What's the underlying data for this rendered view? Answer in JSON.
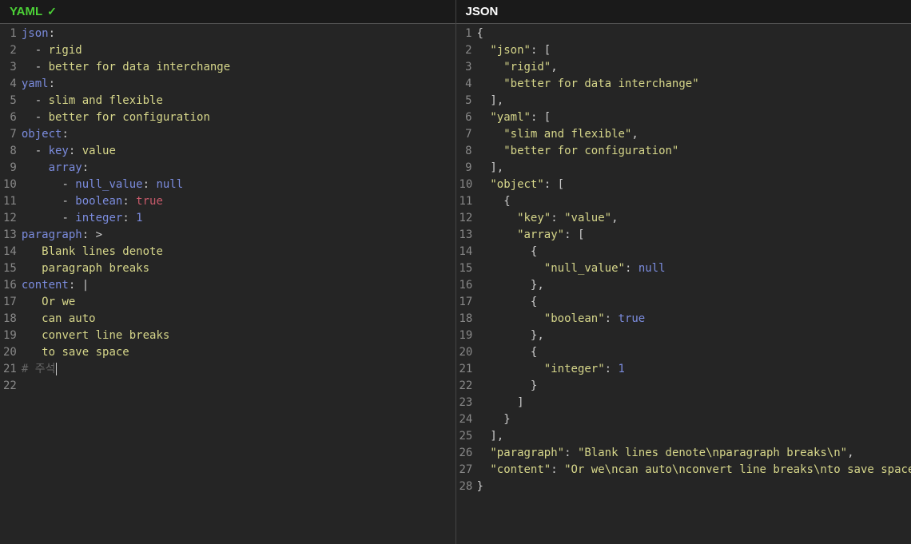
{
  "headers": {
    "yaml": "YAML",
    "check": "✓",
    "json": "JSON"
  },
  "yaml_lines": [
    {
      "n": 1,
      "tokens": [
        [
          "k",
          "json"
        ],
        [
          "p",
          ":"
        ]
      ]
    },
    {
      "n": 2,
      "tokens": [
        [
          "p",
          "  "
        ],
        [
          "d",
          "- "
        ],
        [
          "s",
          "rigid"
        ]
      ]
    },
    {
      "n": 3,
      "tokens": [
        [
          "p",
          "  "
        ],
        [
          "d",
          "- "
        ],
        [
          "s",
          "better for data interchange"
        ]
      ]
    },
    {
      "n": 4,
      "tokens": [
        [
          "k",
          "yaml"
        ],
        [
          "p",
          ":"
        ]
      ]
    },
    {
      "n": 5,
      "tokens": [
        [
          "p",
          "  "
        ],
        [
          "d",
          "- "
        ],
        [
          "s",
          "slim and flexible"
        ]
      ]
    },
    {
      "n": 6,
      "tokens": [
        [
          "p",
          "  "
        ],
        [
          "d",
          "- "
        ],
        [
          "s",
          "better for configuration"
        ]
      ]
    },
    {
      "n": 7,
      "tokens": [
        [
          "k",
          "object"
        ],
        [
          "p",
          ":"
        ]
      ]
    },
    {
      "n": 8,
      "tokens": [
        [
          "p",
          "  "
        ],
        [
          "d",
          "- "
        ],
        [
          "k",
          "key"
        ],
        [
          "p",
          ": "
        ],
        [
          "s",
          "value"
        ]
      ]
    },
    {
      "n": 9,
      "tokens": [
        [
          "p",
          "    "
        ],
        [
          "k",
          "array"
        ],
        [
          "p",
          ":"
        ]
      ]
    },
    {
      "n": 10,
      "tokens": [
        [
          "p",
          "      "
        ],
        [
          "d",
          "- "
        ],
        [
          "k",
          "null_value"
        ],
        [
          "p",
          ": "
        ],
        [
          "n",
          "null"
        ]
      ]
    },
    {
      "n": 11,
      "tokens": [
        [
          "p",
          "      "
        ],
        [
          "d",
          "- "
        ],
        [
          "k",
          "boolean"
        ],
        [
          "p",
          ": "
        ],
        [
          "b",
          "true"
        ]
      ]
    },
    {
      "n": 12,
      "tokens": [
        [
          "p",
          "      "
        ],
        [
          "d",
          "- "
        ],
        [
          "k",
          "integer"
        ],
        [
          "p",
          ": "
        ],
        [
          "i",
          "1"
        ]
      ]
    },
    {
      "n": 13,
      "tokens": [
        [
          "k",
          "paragraph"
        ],
        [
          "p",
          ": >"
        ]
      ]
    },
    {
      "n": 14,
      "tokens": [
        [
          "p",
          "   "
        ],
        [
          "s",
          "Blank lines denote"
        ]
      ]
    },
    {
      "n": 15,
      "tokens": [
        [
          "p",
          ""
        ]
      ]
    },
    {
      "n": 16,
      "tokens": [
        [
          "p",
          "   "
        ],
        [
          "s",
          "paragraph breaks"
        ]
      ]
    },
    {
      "n": 17,
      "tokens": [
        [
          "k",
          "content"
        ],
        [
          "p",
          ": |"
        ]
      ]
    },
    {
      "n": 18,
      "tokens": [
        [
          "p",
          "   "
        ],
        [
          "s",
          "Or we"
        ]
      ]
    },
    {
      "n": 19,
      "tokens": [
        [
          "p",
          "   "
        ],
        [
          "s",
          "can auto"
        ]
      ]
    },
    {
      "n": 20,
      "tokens": [
        [
          "p",
          "   "
        ],
        [
          "s",
          "convert line breaks"
        ]
      ]
    },
    {
      "n": 21,
      "tokens": [
        [
          "p",
          "   "
        ],
        [
          "s",
          "to save space"
        ]
      ]
    },
    {
      "n": 22,
      "tokens": [
        [
          "c",
          "# 주석"
        ]
      ],
      "cursor": true
    }
  ],
  "json_lines": [
    {
      "n": 1,
      "tokens": [
        [
          "jp",
          "{"
        ]
      ]
    },
    {
      "n": 2,
      "tokens": [
        [
          "jp",
          "  "
        ],
        [
          "jk",
          "\"json\""
        ],
        [
          "jp",
          ": ["
        ]
      ]
    },
    {
      "n": 3,
      "tokens": [
        [
          "jp",
          "    "
        ],
        [
          "jv",
          "\"rigid\""
        ],
        [
          "jp",
          ","
        ]
      ]
    },
    {
      "n": 4,
      "tokens": [
        [
          "jp",
          "    "
        ],
        [
          "jv",
          "\"better for data interchange\""
        ]
      ]
    },
    {
      "n": 5,
      "tokens": [
        [
          "jp",
          "  ],"
        ]
      ]
    },
    {
      "n": 6,
      "tokens": [
        [
          "jp",
          "  "
        ],
        [
          "jk",
          "\"yaml\""
        ],
        [
          "jp",
          ": ["
        ]
      ]
    },
    {
      "n": 7,
      "tokens": [
        [
          "jp",
          "    "
        ],
        [
          "jv",
          "\"slim and flexible\""
        ],
        [
          "jp",
          ","
        ]
      ]
    },
    {
      "n": 8,
      "tokens": [
        [
          "jp",
          "    "
        ],
        [
          "jv",
          "\"better for configuration\""
        ]
      ]
    },
    {
      "n": 9,
      "tokens": [
        [
          "jp",
          "  ],"
        ]
      ]
    },
    {
      "n": 10,
      "tokens": [
        [
          "jp",
          "  "
        ],
        [
          "jk",
          "\"object\""
        ],
        [
          "jp",
          ": ["
        ]
      ]
    },
    {
      "n": 11,
      "tokens": [
        [
          "jp",
          "    {"
        ]
      ]
    },
    {
      "n": 12,
      "tokens": [
        [
          "jp",
          "      "
        ],
        [
          "jk",
          "\"key\""
        ],
        [
          "jp",
          ": "
        ],
        [
          "jv",
          "\"value\""
        ],
        [
          "jp",
          ","
        ]
      ]
    },
    {
      "n": 13,
      "tokens": [
        [
          "jp",
          "      "
        ],
        [
          "jk",
          "\"array\""
        ],
        [
          "jp",
          ": ["
        ]
      ]
    },
    {
      "n": 14,
      "tokens": [
        [
          "jp",
          "        {"
        ]
      ]
    },
    {
      "n": 15,
      "tokens": [
        [
          "jp",
          "          "
        ],
        [
          "jk",
          "\"null_value\""
        ],
        [
          "jp",
          ": "
        ],
        [
          "jn",
          "null"
        ]
      ]
    },
    {
      "n": 16,
      "tokens": [
        [
          "jp",
          "        },"
        ]
      ]
    },
    {
      "n": 17,
      "tokens": [
        [
          "jp",
          "        {"
        ]
      ]
    },
    {
      "n": 18,
      "tokens": [
        [
          "jp",
          "          "
        ],
        [
          "jk",
          "\"boolean\""
        ],
        [
          "jp",
          ": "
        ],
        [
          "jb",
          "true"
        ]
      ]
    },
    {
      "n": 19,
      "tokens": [
        [
          "jp",
          "        },"
        ]
      ]
    },
    {
      "n": 20,
      "tokens": [
        [
          "jp",
          "        {"
        ]
      ]
    },
    {
      "n": 21,
      "tokens": [
        [
          "jp",
          "          "
        ],
        [
          "jk",
          "\"integer\""
        ],
        [
          "jp",
          ": "
        ],
        [
          "ji",
          "1"
        ]
      ]
    },
    {
      "n": 22,
      "tokens": [
        [
          "jp",
          "        }"
        ]
      ]
    },
    {
      "n": 23,
      "tokens": [
        [
          "jp",
          "      ]"
        ]
      ]
    },
    {
      "n": 24,
      "tokens": [
        [
          "jp",
          "    }"
        ]
      ]
    },
    {
      "n": 25,
      "tokens": [
        [
          "jp",
          "  ],"
        ]
      ]
    },
    {
      "n": 26,
      "tokens": [
        [
          "jp",
          "  "
        ],
        [
          "jk",
          "\"paragraph\""
        ],
        [
          "jp",
          ": "
        ],
        [
          "jv",
          "\"Blank lines denote\\nparagraph breaks\\n\""
        ],
        [
          "jp",
          ","
        ]
      ]
    },
    {
      "n": 27,
      "tokens": [
        [
          "jp",
          "  "
        ],
        [
          "jk",
          "\"content\""
        ],
        [
          "jp",
          ": "
        ],
        [
          "jv",
          "\"Or we\\ncan auto\\nconvert line breaks\\nto save space\\n\""
        ]
      ]
    },
    {
      "n": 28,
      "tokens": [
        [
          "jp",
          "}"
        ]
      ]
    }
  ]
}
